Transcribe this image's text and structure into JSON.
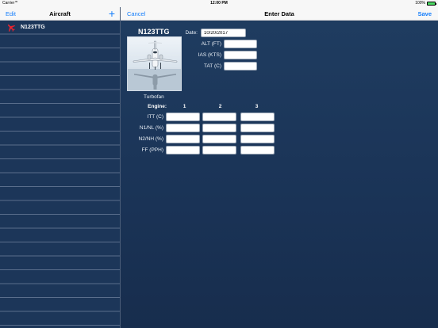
{
  "status_bar": {
    "carrier": "Carrier",
    "time": "12:00 PM",
    "battery": "100%"
  },
  "sidebar_nav": {
    "edit_label": "Edit",
    "title": "Aircraft",
    "add_label": "+"
  },
  "aircraft_list": [
    {
      "tail": "N123TTG"
    }
  ],
  "main_nav": {
    "cancel_label": "Cancel",
    "title": "Enter Data",
    "save_label": "Save"
  },
  "aircraft": {
    "tail": "N123TTG",
    "type": "Turbofan"
  },
  "form": {
    "date_label": "Date:",
    "date_value": "10/20/2017",
    "alt_label": "ALT (FT)",
    "ias_label": "IAS (KTS)",
    "tat_label": "TAT (C)",
    "engine_label": "Engine:",
    "engines": [
      "1",
      "2",
      "3"
    ],
    "rows": [
      "ITT (C)",
      "N1/NL (%)",
      "N2/NH (%)",
      "FF (PPH)"
    ]
  },
  "colors": {
    "accent": "#157efb",
    "background": "#1b3356",
    "plane_icon": "#e8242f"
  }
}
